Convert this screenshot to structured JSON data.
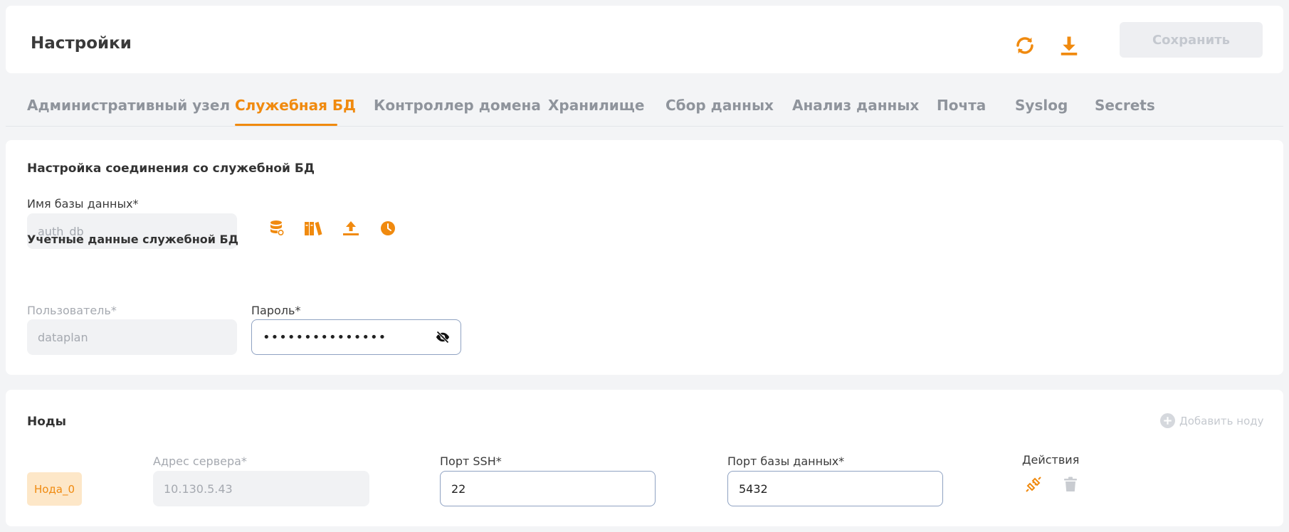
{
  "header": {
    "title": "Настройки",
    "refresh_icon": "refresh-icon",
    "download_icon": "download-icon",
    "save_label": "Сохранить"
  },
  "tabs": [
    {
      "label": "Административный узел",
      "active": false
    },
    {
      "label": "Служебная БД",
      "active": true
    },
    {
      "label": "Контроллер домена",
      "active": false
    },
    {
      "label": "Хранилище",
      "active": false
    },
    {
      "label": "Сбор данных",
      "active": false
    },
    {
      "label": "Анализ данных",
      "active": false
    },
    {
      "label": "Почта",
      "active": false
    },
    {
      "label": "Syslog",
      "active": false
    },
    {
      "label": "Secrets",
      "active": false
    }
  ],
  "connection": {
    "title": "Настройка соединения со служебной БД",
    "db_name_label": "Имя базы данных*",
    "db_name_value": "auth_db",
    "db_icons": [
      "database-icon",
      "books-icon",
      "upload-icon",
      "clock-icon"
    ],
    "credentials_title": "Учетные данные служебной БД",
    "user_label": "Пользователь*",
    "user_value": "dataplan",
    "password_label": "Пароль*",
    "password_value": "•••••••••••••••",
    "password_toggle_icon": "eye-off-icon"
  },
  "nodes": {
    "title": "Ноды",
    "add_label": "Добавить ноду",
    "items": [
      {
        "name": "Нода_0",
        "server_label": "Адрес сервера*",
        "server_value": "10.130.5.43",
        "ssh_label": "Порт SSH*",
        "ssh_value": "22",
        "db_port_label": "Порт базы данных*",
        "db_port_value": "5432",
        "actions_label": "Действия"
      }
    ]
  },
  "colors": {
    "accent": "#f08a0f",
    "muted": "#a5a9b0"
  }
}
